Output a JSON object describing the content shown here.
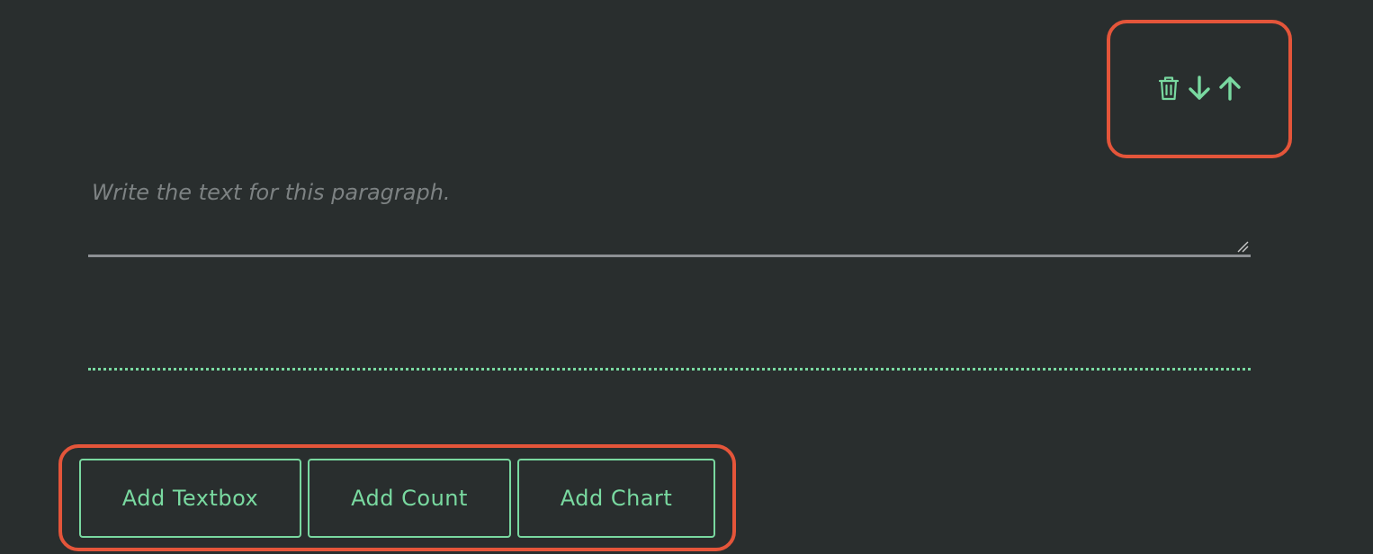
{
  "block_actions": {
    "icons": [
      "trash-icon",
      "arrow-down-icon",
      "arrow-up-icon"
    ]
  },
  "paragraph": {
    "placeholder": "Write the text for this paragraph.",
    "value": ""
  },
  "add_buttons": {
    "textbox_label": "Add Textbox",
    "count_label": "Add Count",
    "chart_label": "Add Chart"
  },
  "colors": {
    "background": "#292e2e",
    "accent": "#79d9a0",
    "highlight": "#e4553a",
    "underline": "#8d9094"
  }
}
